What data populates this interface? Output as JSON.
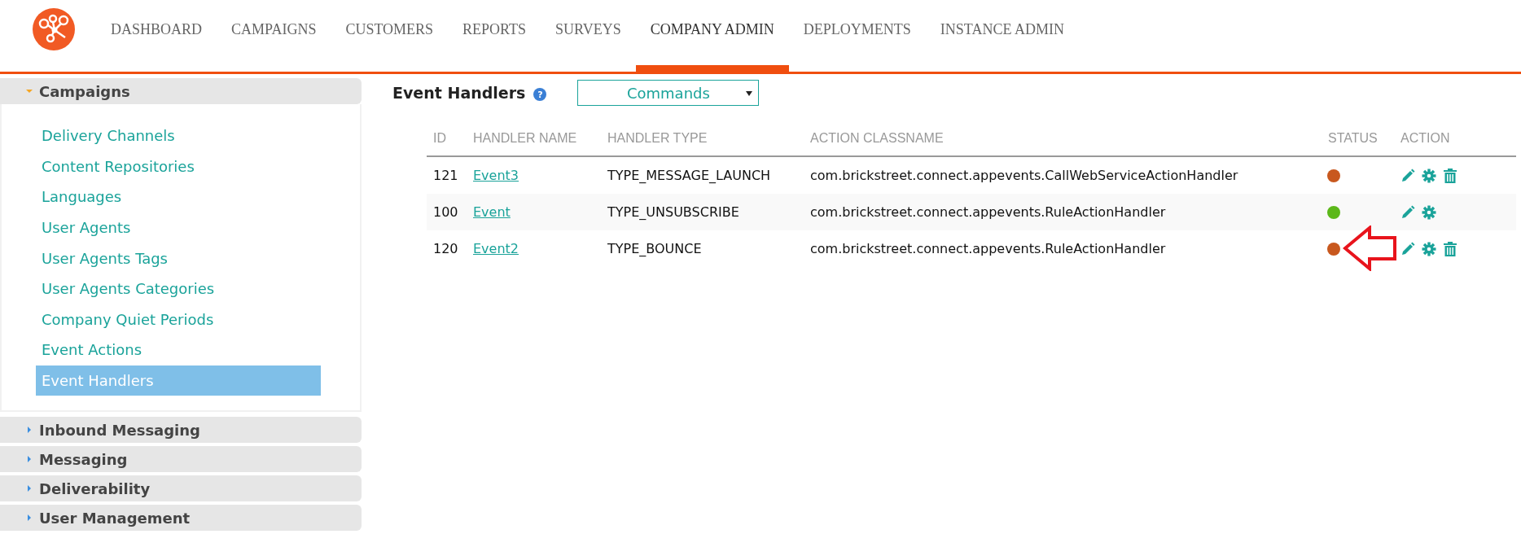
{
  "nav": [
    {
      "label": "DASHBOARD",
      "selected": false
    },
    {
      "label": "CAMPAIGNS",
      "selected": false
    },
    {
      "label": "CUSTOMERS",
      "selected": false
    },
    {
      "label": "REPORTS",
      "selected": false
    },
    {
      "label": "SURVEYS",
      "selected": false
    },
    {
      "label": "COMPANY ADMIN",
      "selected": true
    },
    {
      "label": "DEPLOYMENTS",
      "selected": false
    },
    {
      "label": "INSTANCE ADMIN",
      "selected": false
    }
  ],
  "sidebar": {
    "sections": [
      {
        "label": "Campaigns",
        "expanded": true,
        "items": [
          {
            "label": "Delivery Channels",
            "selected": false
          },
          {
            "label": "Content Repositories",
            "selected": false
          },
          {
            "label": "Languages",
            "selected": false
          },
          {
            "label": "User Agents",
            "selected": false
          },
          {
            "label": "User Agents Tags",
            "selected": false
          },
          {
            "label": "User Agents Categories",
            "selected": false
          },
          {
            "label": "Company Quiet Periods",
            "selected": false
          },
          {
            "label": "Event Actions",
            "selected": false
          },
          {
            "label": "Event Handlers",
            "selected": true
          }
        ]
      },
      {
        "label": "Inbound Messaging",
        "expanded": false
      },
      {
        "label": "Messaging",
        "expanded": false
      },
      {
        "label": "Deliverability",
        "expanded": false
      },
      {
        "label": "User Management",
        "expanded": false
      }
    ]
  },
  "page": {
    "title": "Event Handlers",
    "help": "?",
    "dropdown": {
      "value": "Commands"
    }
  },
  "table": {
    "columns": [
      "ID",
      "HANDLER NAME",
      "HANDLER TYPE",
      "ACTION CLASSNAME",
      "STATUS",
      "ACTION"
    ],
    "rows": [
      {
        "id": "121",
        "name": "Event3",
        "type": "TYPE_MESSAGE_LAUNCH",
        "classname": "com.brickstreet.connect.appevents.CallWebServiceActionHandler",
        "color": "#c8581e",
        "deletable": true,
        "highlighted": false
      },
      {
        "id": "100",
        "name": "Event",
        "type": "TYPE_UNSUBSCRIBE",
        "classname": "com.brickstreet.connect.appevents.RuleActionHandler",
        "color": "#5cb81a",
        "deletable": false,
        "highlighted": false
      },
      {
        "id": "120",
        "name": "Event2",
        "type": "TYPE_BOUNCE",
        "classname": "com.brickstreet.connect.appevents.RuleActionHandler",
        "color": "#c8581e",
        "deletable": true,
        "highlighted": true
      }
    ]
  }
}
